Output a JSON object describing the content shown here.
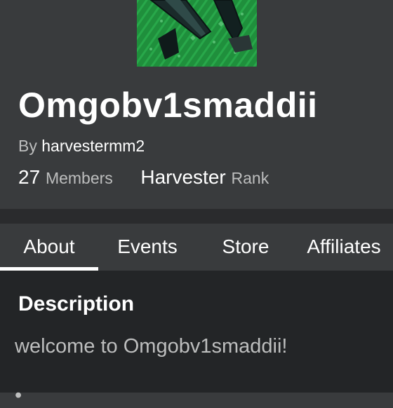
{
  "group": {
    "name": "Omgobv1smaddii",
    "owner_prefix": "By",
    "owner_name": "harvestermm2",
    "members_count": "27",
    "members_label": "Members",
    "rank_value": "Harvester",
    "rank_label": "Rank",
    "emblem_icon": "group-emblem-green-knife"
  },
  "tabs": [
    {
      "label": "About",
      "selected": true
    },
    {
      "label": "Events",
      "selected": false
    },
    {
      "label": "Store",
      "selected": false
    },
    {
      "label": "Affiliates",
      "selected": false
    }
  ],
  "description": {
    "heading": "Description",
    "text": "welcome to Omgobv1smaddii!",
    "next_line_fragment": "•"
  },
  "colors": {
    "header_bg": "#393b3d",
    "content_bg": "#232527",
    "muted_text": "#bdbebe",
    "emblem_green": "#1e8a3a"
  }
}
